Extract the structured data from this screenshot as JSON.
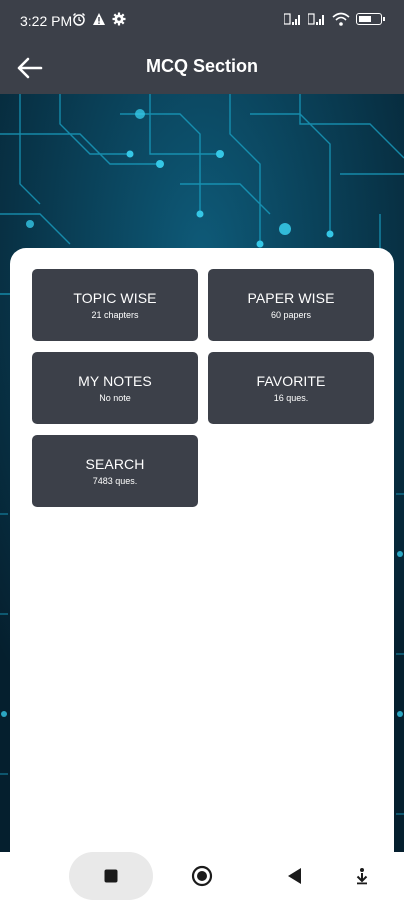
{
  "status_bar": {
    "time": "3:22 PM",
    "left_icons": [
      "alarm-icon",
      "warning-icon",
      "gear-icon"
    ],
    "right_icons": [
      "sim-signal-icon",
      "sim-signal-icon",
      "wifi-icon",
      "battery-icon"
    ],
    "battery_level": 0.6
  },
  "app_bar": {
    "title": "MCQ Section",
    "back_icon": "arrow-left-icon"
  },
  "tiles": [
    {
      "title": "TOPIC WISE",
      "subtitle": "21 chapters"
    },
    {
      "title": "PAPER WISE",
      "subtitle": "60 papers"
    },
    {
      "title": "MY NOTES",
      "subtitle": "No note"
    },
    {
      "title": "FAVORITE",
      "subtitle": "16 ques."
    },
    {
      "title": "SEARCH",
      "subtitle": "7483 ques."
    }
  ],
  "nav_bar": {
    "items": [
      "recents-square-icon",
      "home-circle-icon",
      "back-triangle-icon",
      "hide-nav-icon"
    ]
  },
  "colors": {
    "bar_bg": "#3c4049",
    "tile_bg": "#3c4049",
    "circuit_bg": "#072a3c",
    "circuit_glow": "#35c7e6"
  }
}
